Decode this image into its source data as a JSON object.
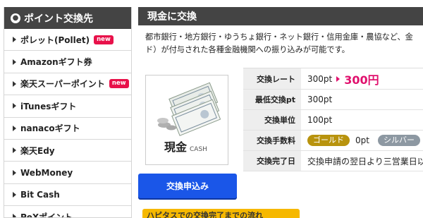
{
  "sidebar": {
    "header": "ポイント交換先",
    "items": [
      {
        "label": "ポレット(Pollet)",
        "new": true
      },
      {
        "label": "Amazonギフト券",
        "new": false
      },
      {
        "label": "楽天スーパーポイント",
        "new": true
      },
      {
        "label": "iTunesギフト",
        "new": false
      },
      {
        "label": "nanacoギフト",
        "new": false
      },
      {
        "label": "楽天Edy",
        "new": false
      },
      {
        "label": "WebMoney",
        "new": false
      },
      {
        "label": "Bit Cash",
        "new": false
      },
      {
        "label": "PeXポイント",
        "new": false
      }
    ],
    "new_badge": "new"
  },
  "main": {
    "title": "現金に交換",
    "description_line1": "都市銀行・地方銀行・ゆうちょ銀行・ネット銀行・信用金庫・農協など、金",
    "description_line2": "ド）が付与された各種金融機関への振り込みが可能です。",
    "thumb_main": "現金",
    "thumb_sub": "CASH",
    "apply_button": "交換申込み",
    "banner": "ハピタスでの交換完了までの流れ"
  },
  "table": {
    "rate_label": "交換レート",
    "rate_from": "300pt",
    "rate_to": "300円",
    "min_label": "最低交換pt",
    "min_value": "300pt",
    "unit_label": "交換単位",
    "unit_value": "100pt",
    "fee_label": "交換手数料",
    "fee_gold": "ゴールド",
    "fee_gold_value": "0pt",
    "fee_silver": "シルバー",
    "done_label": "交換完了日",
    "done_value": "交換申請の翌日より三営業日以"
  },
  "colors": {
    "header_bg": "#444444",
    "accent_pink": "#e0106d",
    "button_blue": "#1a56e8",
    "new_badge": "#e8114a",
    "gold": "#b8930e",
    "silver": "#8d98a2",
    "banner_yellow": "#f6b800"
  }
}
